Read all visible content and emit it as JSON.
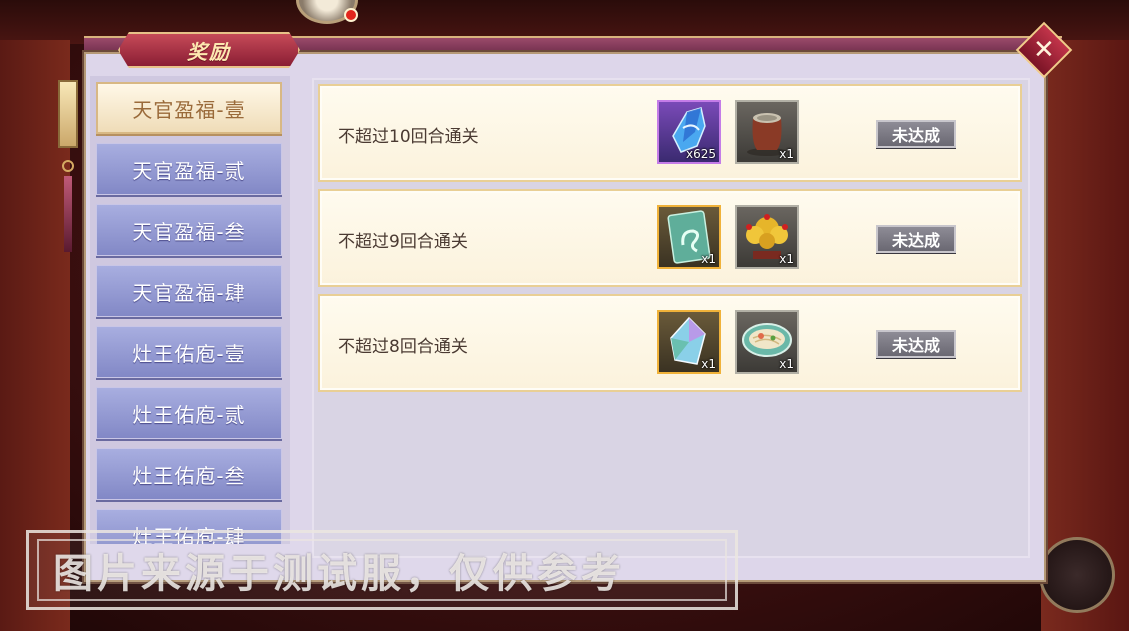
{
  "header": {
    "title": "奖励",
    "close_icon": "close-x-icon"
  },
  "colors": {
    "panel_bg": "#ddd6ea",
    "tab_active_bg": "#f7ebd2",
    "tab_inactive_bg": "#959ad4",
    "title_tab_bg": "#a8283e",
    "status_button_bg": "#7c7a84",
    "purple_rarity": "#c47ce8",
    "gold_rarity": "#f0b23a"
  },
  "sidebar": {
    "items": [
      {
        "label": "天官盈福-壹",
        "active": true
      },
      {
        "label": "天官盈福-贰",
        "active": false
      },
      {
        "label": "天官盈福-叁",
        "active": false
      },
      {
        "label": "天官盈福-肆",
        "active": false
      },
      {
        "label": "灶王佑庖-壹",
        "active": false
      },
      {
        "label": "灶王佑庖-贰",
        "active": false
      },
      {
        "label": "灶王佑庖-叁",
        "active": false
      },
      {
        "label": "灶王佑庖-肆",
        "active": false
      }
    ]
  },
  "tasks": [
    {
      "description": "不超过10回合通关",
      "status": "未达成",
      "rewards": [
        {
          "icon": "blue-crystal-icon",
          "rarity": "purple",
          "qty": "x625"
        },
        {
          "icon": "clay-jar-icon",
          "rarity": "grey",
          "qty": "x1"
        }
      ]
    },
    {
      "description": "不超过9回合通关",
      "status": "未达成",
      "rewards": [
        {
          "icon": "jade-card-icon",
          "rarity": "gold",
          "qty": "x1"
        },
        {
          "icon": "golden-bonsai-icon",
          "rarity": "grey",
          "qty": "x1"
        }
      ]
    },
    {
      "description": "不超过8回合通关",
      "status": "未达成",
      "rewards": [
        {
          "icon": "prism-crystal-icon",
          "rarity": "gold",
          "qty": "x1"
        },
        {
          "icon": "noodle-bowl-icon",
          "rarity": "grey",
          "qty": "x1"
        }
      ]
    }
  ],
  "watermark": {
    "text": "图片来源于测试服，仅供参考"
  }
}
